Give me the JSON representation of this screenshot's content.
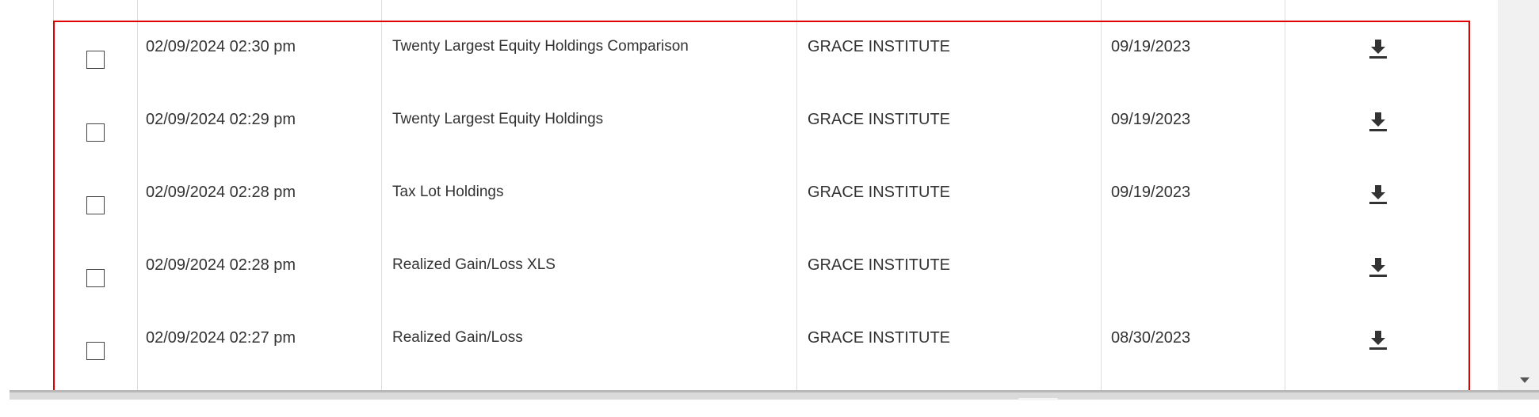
{
  "table": {
    "rows": [
      {
        "created": "02/09/2024 02:30 pm",
        "report": "Twenty Largest Equity Holdings Comparison",
        "account": "GRACE INSTITUTE",
        "as_of": "09/19/2023",
        "checked": false
      },
      {
        "created": "02/09/2024 02:29 pm",
        "report": "Twenty Largest Equity Holdings",
        "account": "GRACE INSTITUTE",
        "as_of": "09/19/2023",
        "checked": false
      },
      {
        "created": "02/09/2024 02:28 pm",
        "report": "Tax Lot Holdings",
        "account": "GRACE INSTITUTE",
        "as_of": "09/19/2023",
        "checked": false
      },
      {
        "created": "02/09/2024 02:28 pm",
        "report": "Realized Gain/Loss XLS",
        "account": "GRACE INSTITUTE",
        "as_of": "",
        "checked": false
      },
      {
        "created": "02/09/2024 02:27 pm",
        "report": "Realized Gain/Loss",
        "account": "GRACE INSTITUTE",
        "as_of": "08/30/2023",
        "checked": false
      }
    ],
    "row_icon": "download-icon",
    "highlight_color": "#e00000"
  }
}
